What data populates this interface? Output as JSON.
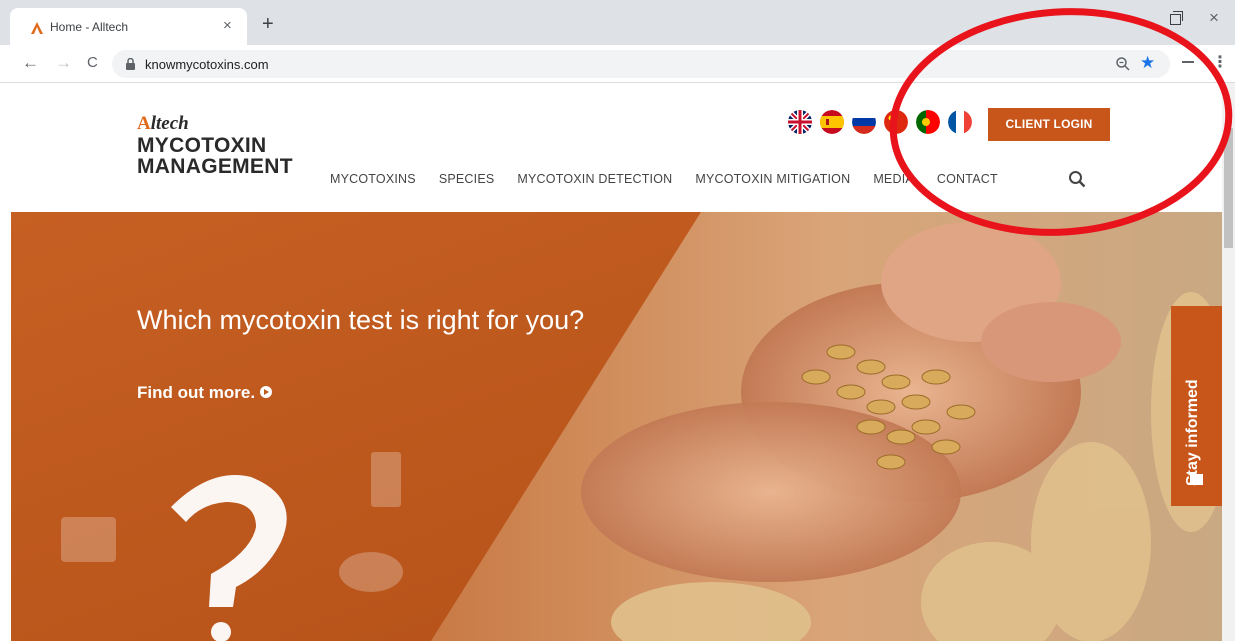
{
  "browser": {
    "tab_title": "Home - Alltech",
    "tab_close": "×",
    "new_tab": "+",
    "back": "←",
    "forward": "→",
    "reload": "C",
    "url": "knowmycotoxins.com",
    "window_close": "×",
    "menu": "⋮",
    "bookmark_star": "★"
  },
  "site": {
    "brand": "ltech",
    "brand_mark": "A",
    "product_line1": "MYCOTOXIN",
    "product_line2": "MANAGEMENT",
    "nav": [
      "MYCOTOXINS",
      "SPECIES",
      "MYCOTOXIN DETECTION",
      "MYCOTOXIN MITIGATION",
      "MEDIA",
      "CONTACT"
    ],
    "languages": [
      "English",
      "Spanish",
      "Russian",
      "Chinese",
      "Portuguese",
      "French"
    ],
    "client_login": "CLIENT LOGIN"
  },
  "hero": {
    "title": "Which mycotoxin test is right for you?",
    "link": "Find out more.",
    "stay_informed": "Stay informed"
  },
  "colors": {
    "accent": "#c8561b",
    "hero_orange": "#c05a1e",
    "annotation_red": "#e8131b"
  }
}
